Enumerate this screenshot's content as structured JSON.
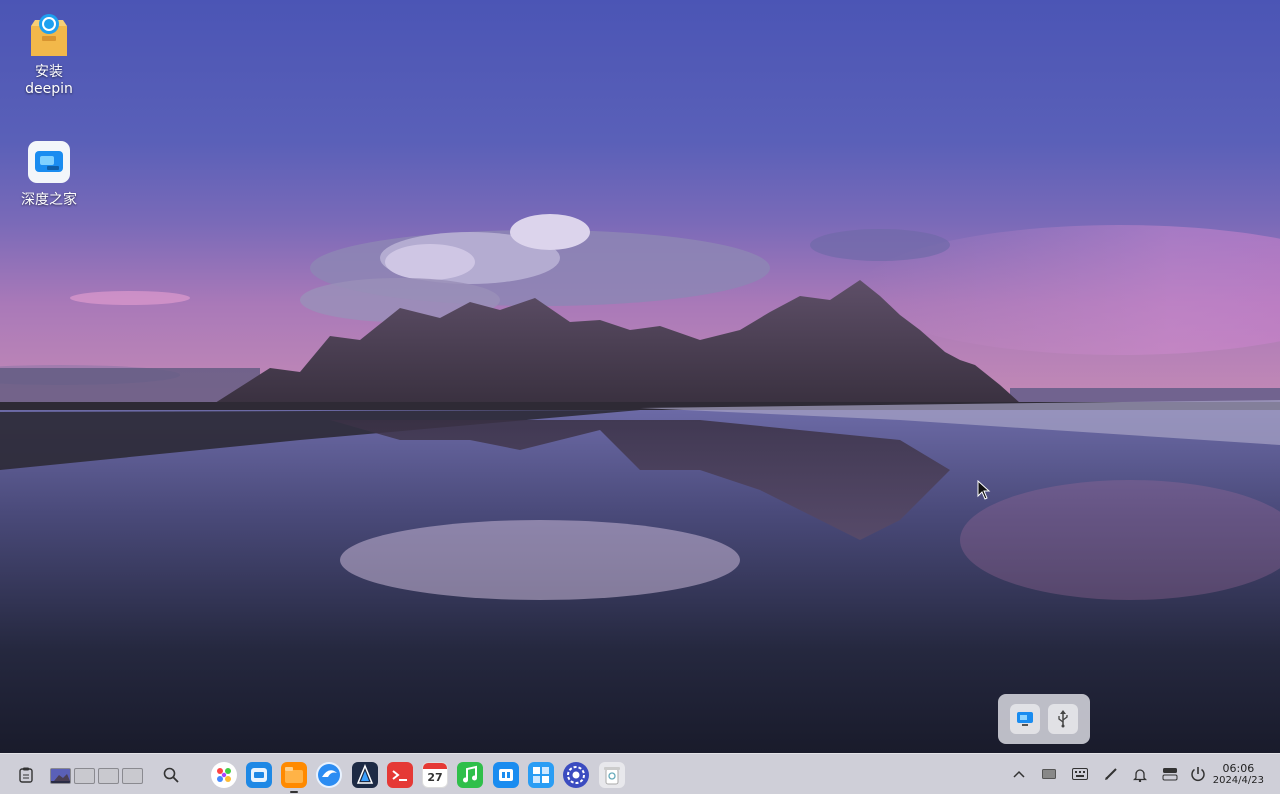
{
  "desktop": {
    "icons": [
      {
        "label_line1": "安装",
        "label_line2": "deepin",
        "icon": "package-box-icon"
      },
      {
        "label_line1": "深度之家",
        "icon": "deepin-home-icon"
      }
    ]
  },
  "tray_popup": {
    "items": [
      {
        "icon": "screen-projection-icon"
      },
      {
        "icon": "usb-icon"
      }
    ]
  },
  "taskbar": {
    "left": {
      "clipboard_icon": "clipboard-icon",
      "workspaces": 4,
      "search_icon": "search-icon"
    },
    "apps": [
      {
        "name": "launcher",
        "icon": "launcher-icon",
        "color": "#ffffff"
      },
      {
        "name": "app-store",
        "icon": "app-store-icon",
        "color": "#1e88e5"
      },
      {
        "name": "file-manager",
        "icon": "file-manager-icon",
        "color": "#ff8a00"
      },
      {
        "name": "browser",
        "icon": "browser-icon",
        "color": "#2b8cf2"
      },
      {
        "name": "editor",
        "icon": "editor-icon",
        "color": "#1d2a44"
      },
      {
        "name": "terminal",
        "icon": "terminal-icon",
        "color": "#e53935"
      },
      {
        "name": "calendar",
        "icon": "calendar-icon",
        "color": "#ffffff",
        "day": "27"
      },
      {
        "name": "music",
        "icon": "music-icon",
        "color": "#2fbf4a"
      },
      {
        "name": "deepin-home",
        "icon": "deepin-home-taskbar-icon",
        "color": "#1a8cf0"
      },
      {
        "name": "app-drawer",
        "icon": "app-grid-icon",
        "color": "#2a9df4"
      },
      {
        "name": "settings",
        "icon": "settings-icon",
        "color": "#3b4cc0"
      },
      {
        "name": "trash",
        "icon": "trash-icon",
        "color": "#e8e8ec"
      }
    ],
    "tray": [
      {
        "icon": "chevron-up-icon"
      },
      {
        "icon": "keyboard-layout-icon"
      },
      {
        "icon": "keyboard-icon"
      },
      {
        "icon": "pen-icon"
      },
      {
        "icon": "bell-icon"
      },
      {
        "icon": "control-center-icon"
      },
      {
        "icon": "power-icon"
      }
    ],
    "clock": {
      "time": "06:06",
      "date": "2024/4/23"
    }
  }
}
